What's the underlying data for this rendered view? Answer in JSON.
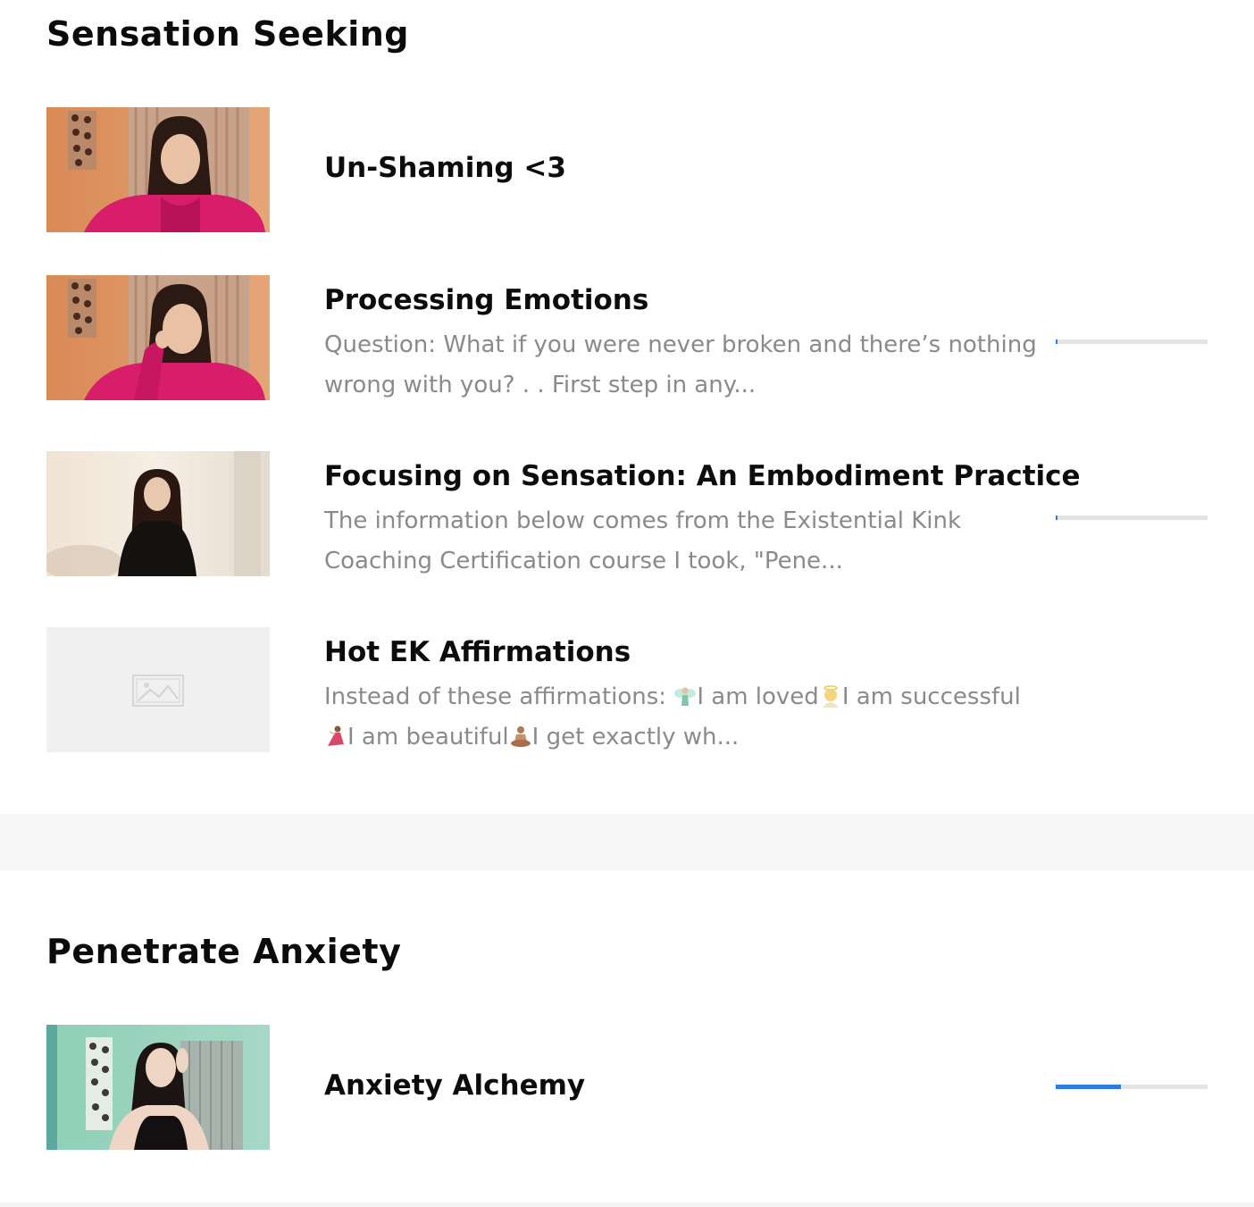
{
  "sections": [
    {
      "title": "Sensation Seeking",
      "lessons": [
        {
          "title": "Un-Shaming <3",
          "description": "",
          "thumbnail": "video-thumbnail-woman-pink-sweater",
          "progress": null
        },
        {
          "title": "Processing Emotions",
          "description": "Question: What if you were never broken and there’s nothing wrong with you? . . First step in any...",
          "thumbnail": "video-thumbnail-woman-thinking",
          "progress": 0.01
        },
        {
          "title": "Focusing on Sensation: An Embodiment Practice",
          "description": "The information below comes from the Existential Kink Coaching Certification course I took, \"Pene...",
          "thumbnail": "video-thumbnail-woman-black-top",
          "progress": 0.01
        },
        {
          "title": "Hot EK Affirmations",
          "description_parts": [
            "Instead of these affirmations: ",
            "I am loved",
            "I am successful ",
            "I am beautiful",
            "I get exactly wh..."
          ],
          "emoji_icons": [
            "fairy-emoji",
            "angel-emoji",
            "dancer-emoji",
            "meditation-emoji"
          ],
          "thumbnail": "image-placeholder-icon",
          "progress": null
        }
      ]
    },
    {
      "title": "Penetrate Anxiety",
      "lessons": [
        {
          "title": "Anxiety Alchemy",
          "description": "",
          "thumbnail": "video-thumbnail-woman-green-room",
          "progress": 0.43
        }
      ]
    }
  ],
  "colors": {
    "progress_fill": "#2f7de1",
    "progress_track": "#e3e3e3",
    "description_text": "#8a8a8a",
    "divider_band": "#f7f7f7"
  }
}
